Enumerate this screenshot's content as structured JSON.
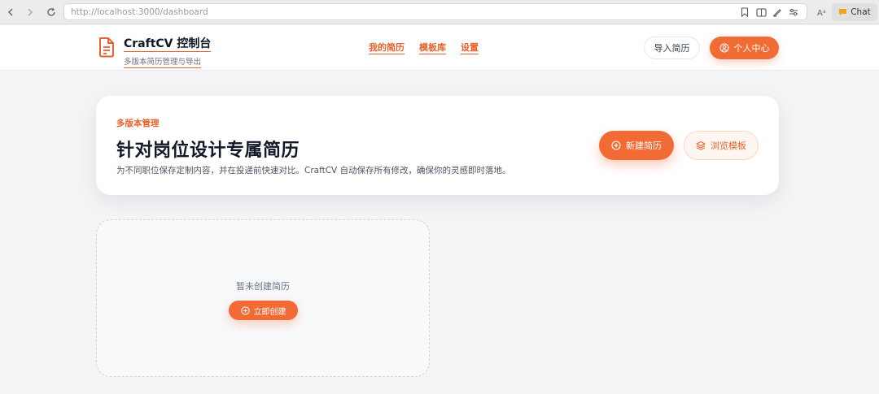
{
  "browser": {
    "url": "http://localhost:3000/dashboard",
    "chat_label": "Chat"
  },
  "header": {
    "brand_title": "CraftCV 控制台",
    "brand_subtitle": "多版本简历管理与导出",
    "nav": [
      {
        "label": "我的简历"
      },
      {
        "label": "模板库"
      },
      {
        "label": "设置"
      }
    ],
    "import_label": "导入简历",
    "profile_label": "个人中心"
  },
  "hero": {
    "kicker": "多版本管理",
    "title": "针对岗位设计专属简历",
    "description": "为不同职位保存定制内容，并在投递前快速对比。CraftCV 自动保存所有修改，确保你的灵感即时落地。",
    "new_label": "新建简历",
    "browse_label": "浏览模板"
  },
  "empty_state": {
    "message": "暂未创建简历",
    "create_label": "立即创建"
  },
  "colors": {
    "accent": "#f26b35",
    "accent_text": "#e8612c",
    "background": "#f3f4f6"
  }
}
